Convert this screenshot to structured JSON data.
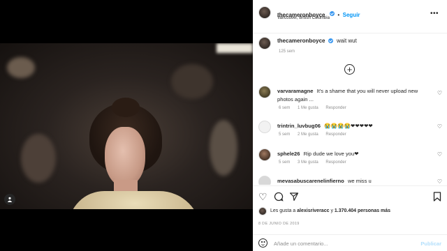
{
  "post": {
    "username": "thecameronboyce",
    "follow_label": "Seguir",
    "separator": "•",
    "location": "Vancouver, British Columbia",
    "more_icon": "more-horizontal-icon",
    "caption": "wait wut",
    "caption_time": "125 sem"
  },
  "comments": [
    {
      "username": "varvaramagne",
      "text": "It's a shame that you will never upload new photos again ...",
      "time": "6 sem",
      "likes": "1 Me gusta",
      "reply": "Responder"
    },
    {
      "username": "trintrin_luvbug06",
      "text": "😭😭😭😭❤❤❤❤❤",
      "time": "5 sem",
      "likes": "2 Me gusta",
      "reply": "Responder"
    },
    {
      "username": "sphele26",
      "text": "Rip dude we love you❤",
      "time": "5 sem",
      "likes": "3 Me gusta",
      "reply": "Responder"
    },
    {
      "username": "mevasabuscarenelinfierno",
      "text": "we miss u",
      "time": "",
      "likes": "",
      "reply": ""
    }
  ],
  "likes": {
    "prefix": "Les gusta a",
    "user": "alexisriveracc",
    "connector": "y",
    "count": "1.370.404 personas más"
  },
  "post_date": "8 DE JUNIO DE 2019",
  "add_comment": {
    "placeholder": "Añade un comentario...",
    "publish_label": "Publicar"
  },
  "colors": {
    "accent": "#0095f6",
    "verified": "#3897f0",
    "muted": "#8e8e8e",
    "heart": "#e0245e"
  }
}
